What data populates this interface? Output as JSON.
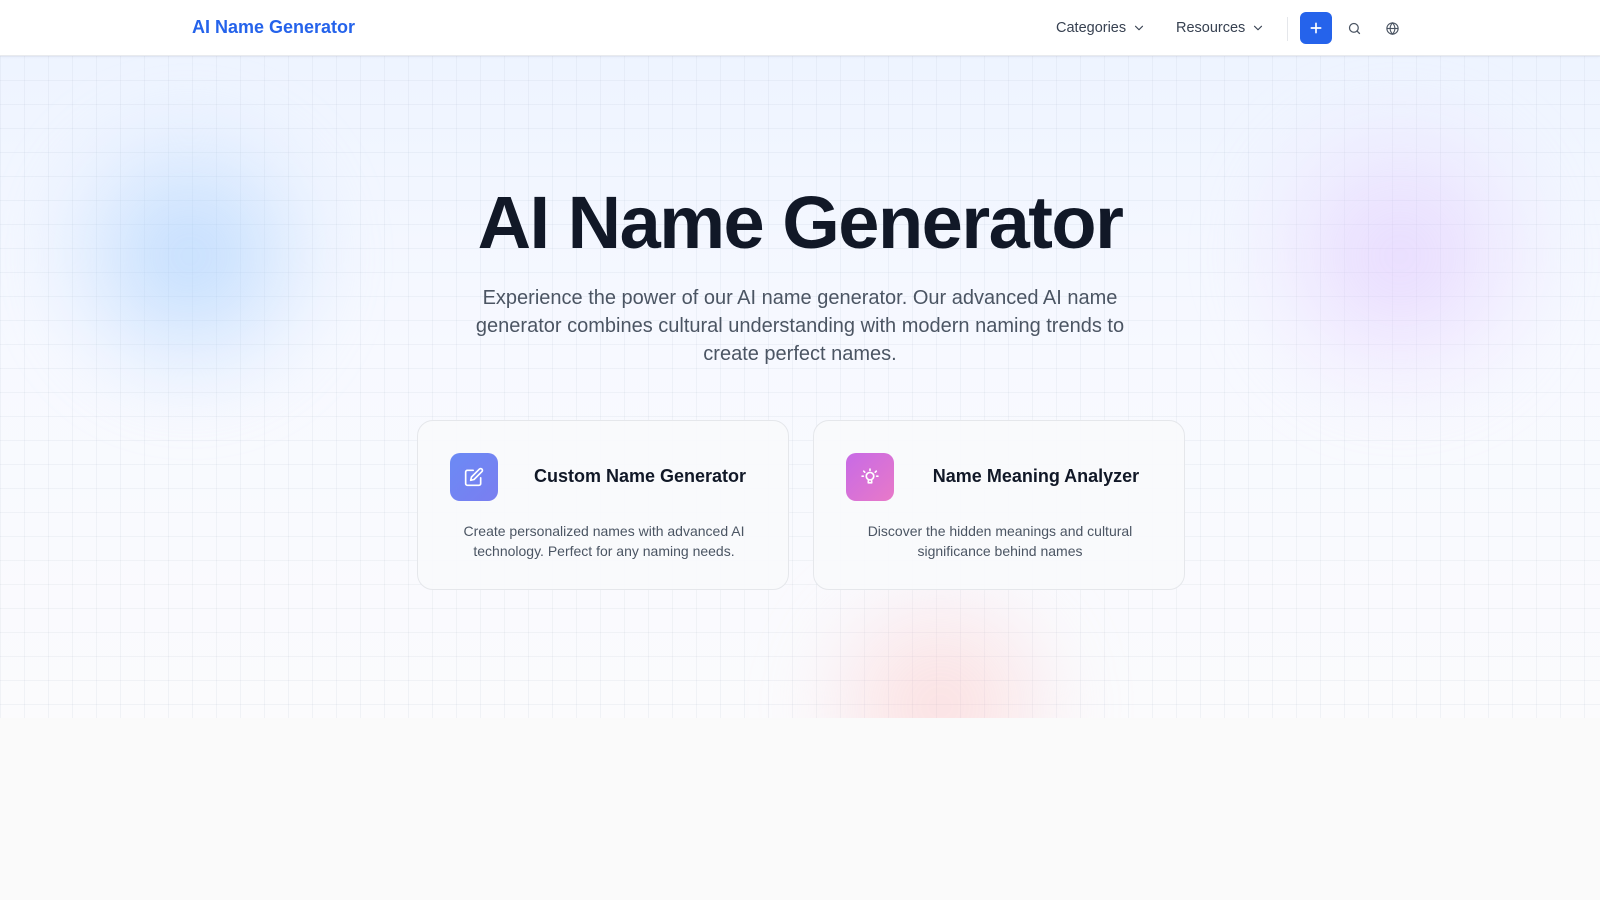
{
  "header": {
    "brand": "AI Name Generator",
    "nav": [
      {
        "label": "Categories",
        "icon": "chevron-down-icon"
      },
      {
        "label": "Resources",
        "icon": "chevron-down-icon"
      }
    ],
    "actions": {
      "add_icon": "plus-icon",
      "search_icon": "search-icon",
      "language_icon": "globe-icon"
    }
  },
  "hero": {
    "title": "AI Name Generator",
    "subtitle": "Experience the power of our AI name generator. Our advanced AI name generator combines cultural understanding with modern naming trends to create perfect names."
  },
  "cards": [
    {
      "title": "Custom Name Generator",
      "description": "Create personalized names with advanced AI technology. Perfect for any naming needs.",
      "icon": "pencil-edit-icon"
    },
    {
      "title": "Name Meaning Analyzer",
      "description": "Discover the hidden meanings and cultural significance behind names",
      "icon": "lightbulb-icon"
    }
  ],
  "colors": {
    "brand": "#2563eb",
    "title": "#111827",
    "body_text": "#4b5563"
  }
}
